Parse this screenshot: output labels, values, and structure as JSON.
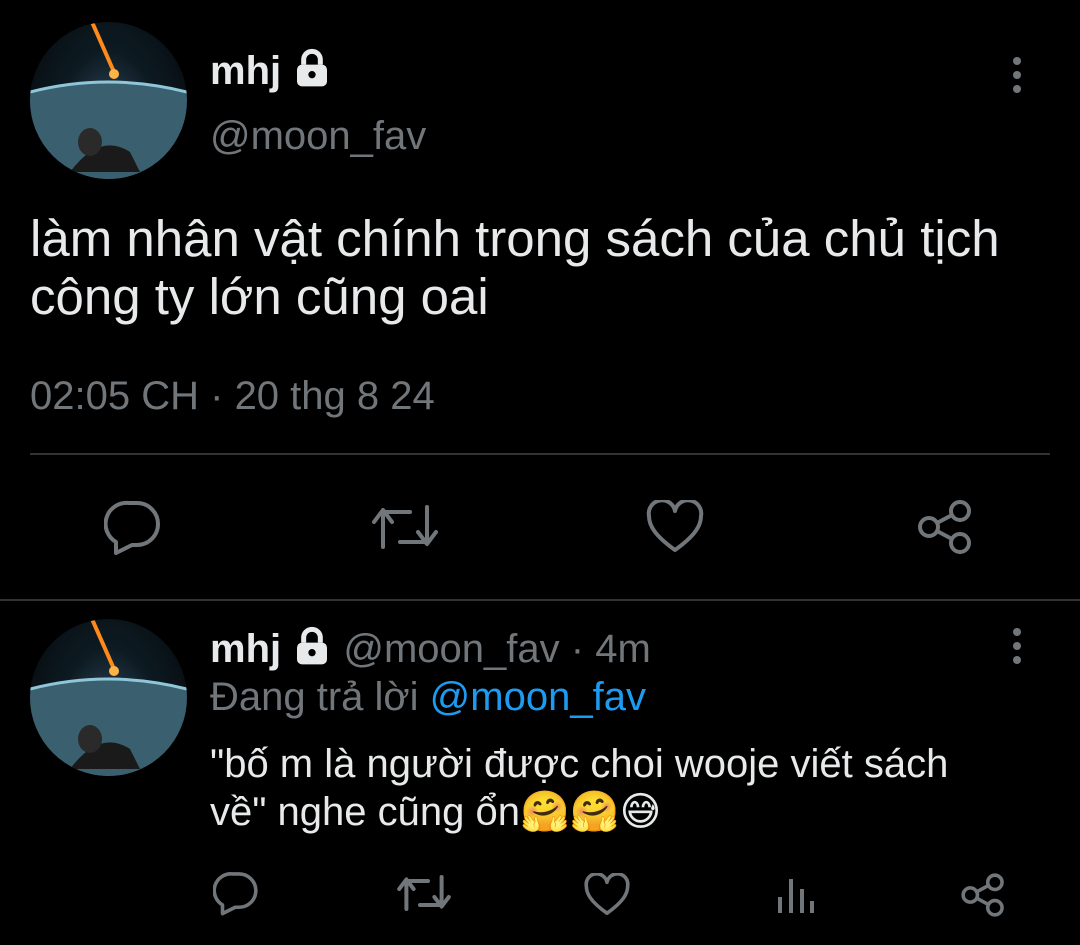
{
  "main_tweet": {
    "display_name": "mhj",
    "handle": "@moon_fav",
    "text_line1": "làm nhân vật chính trong sách của chủ tịch",
    "text_line2": "công ty lớn cũng oai",
    "time": "02:05 CH",
    "separator": "·",
    "date": "20 thg 8 24",
    "actions": [
      "reply-icon",
      "retweet-icon",
      "like-icon",
      "share-icon"
    ]
  },
  "reply_tweet": {
    "display_name": "mhj",
    "handle": "@moon_fav",
    "separator": "·",
    "age": "4m",
    "replying_to_label": "Đang trả lời",
    "replying_to_handle": "@moon_fav",
    "text_line1": "\"bố m là người được choi wooje viết sách",
    "text_line2": "về\" nghe cũng ổn",
    "emojis": [
      "🤗",
      "🤗",
      "😅"
    ],
    "actions": [
      "reply-icon",
      "retweet-icon",
      "like-icon",
      "analytics-icon",
      "share-icon"
    ]
  },
  "colors": {
    "background": "#000000",
    "text": "#e7e9ea",
    "muted": "#71767b",
    "link": "#1d9bf0",
    "divider": "#2f3336"
  }
}
